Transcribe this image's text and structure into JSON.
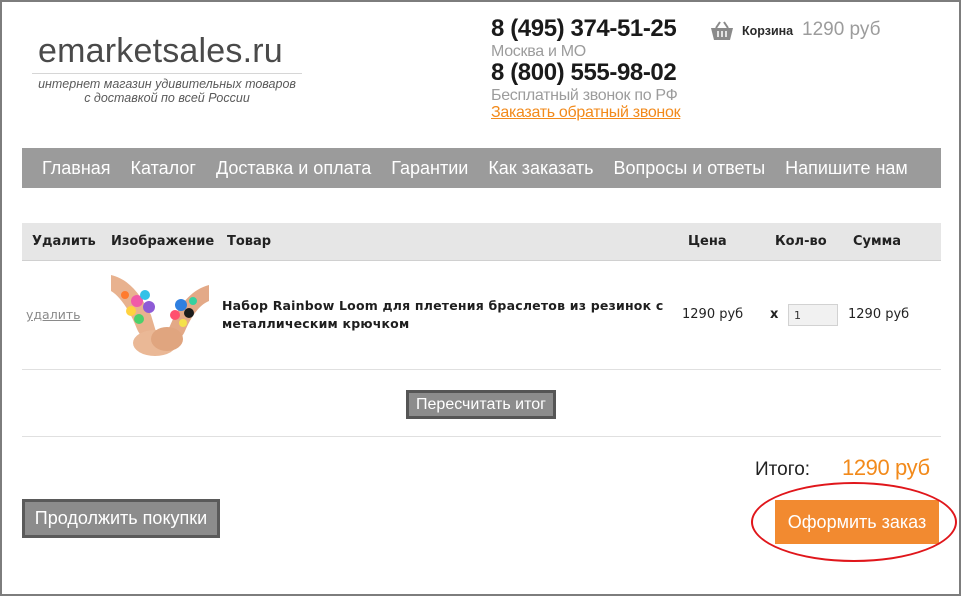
{
  "header": {
    "logo": "emarketsales.ru",
    "tagline_line1": "интернет магазин удивительных товаров",
    "tagline_line2": "с доставкой по всей России",
    "phone1": "8 (495) 374-51-25",
    "phone1_note": "Москва и МО",
    "phone2": "8 (800) 555-98-02",
    "phone2_note": "Бесплатный звонок по РФ",
    "callback_link": "Заказать обратный звонок",
    "cart_icon": "basket-icon",
    "cart_label": "Корзина",
    "cart_total": "1290 руб"
  },
  "nav": {
    "items": [
      "Главная",
      "Каталог",
      "Доставка и оплата",
      "Гарантии",
      "Как заказать",
      "Вопросы и ответы",
      "Напишите нам"
    ]
  },
  "table": {
    "headers": {
      "delete": "Удалить",
      "image": "Изображение",
      "product": "Товар",
      "price": "Цена",
      "qty": "Кол-во",
      "sum": "Сумма"
    },
    "rows": [
      {
        "delete_link": "удалить",
        "name": "Набор Rainbow Loom для плетения браслетов из резинок с металлическим крючком",
        "price": "1290 руб",
        "times": "x",
        "qty": "1",
        "sum": "1290 руб"
      }
    ]
  },
  "actions": {
    "recalculate": "Пересчитать итог",
    "continue_shopping": "Продолжить покупки",
    "checkout": "Оформить заказ"
  },
  "summary": {
    "total_label": "Итого:",
    "total_value": "1290 руб"
  },
  "colors": {
    "accent": "#f28a1b",
    "nav_bg": "#9b9b9b",
    "highlight": "#e0161b"
  }
}
